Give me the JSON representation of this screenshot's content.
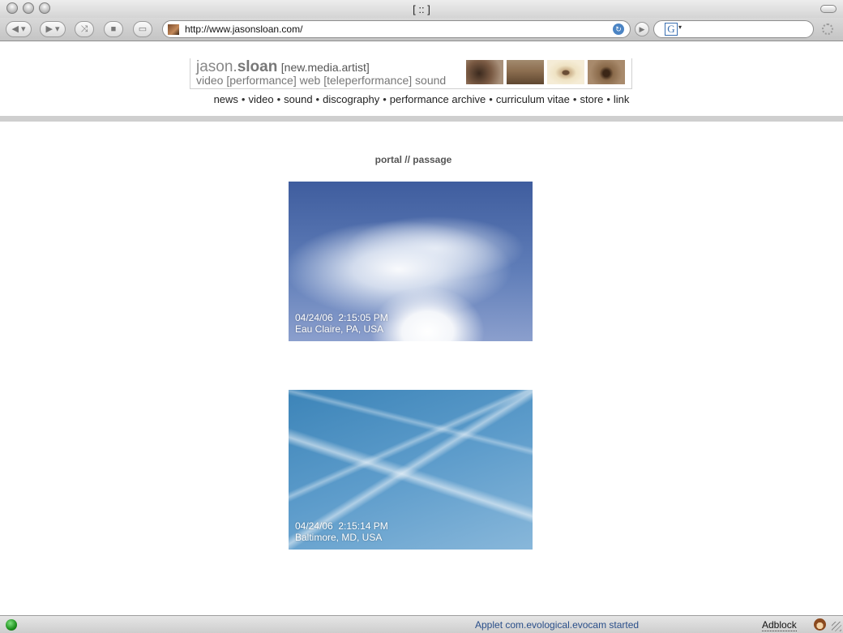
{
  "window": {
    "title": "[ :: ]"
  },
  "toolbar": {
    "url": "http://www.jasonsloan.com/",
    "search_value": ""
  },
  "site": {
    "name_first": "jason.",
    "name_last": "sloan",
    "role": "[new.media.artist]",
    "tagline": "video [performance] web [teleperformance] sound",
    "nav": [
      "news",
      "video",
      "sound",
      "discography",
      "performance archive",
      "curriculum vitae",
      "store",
      "link"
    ],
    "nav_separator": "•"
  },
  "main": {
    "title": "portal // passage",
    "cams": [
      {
        "timestamp": "04/24/06  2:15:05 PM",
        "location": "Eau Claire, PA, USA"
      },
      {
        "timestamp": "04/24/06  2:15:14 PM",
        "location": "Baltimore, MD, USA"
      }
    ]
  },
  "statusbar": {
    "message": "Applet com.evological.evocam started",
    "adblock_label": "Adblock"
  },
  "colors": {
    "nav_stripe": "#cfcfcf",
    "status_link": "#2a4f8a",
    "title": "#555555"
  }
}
